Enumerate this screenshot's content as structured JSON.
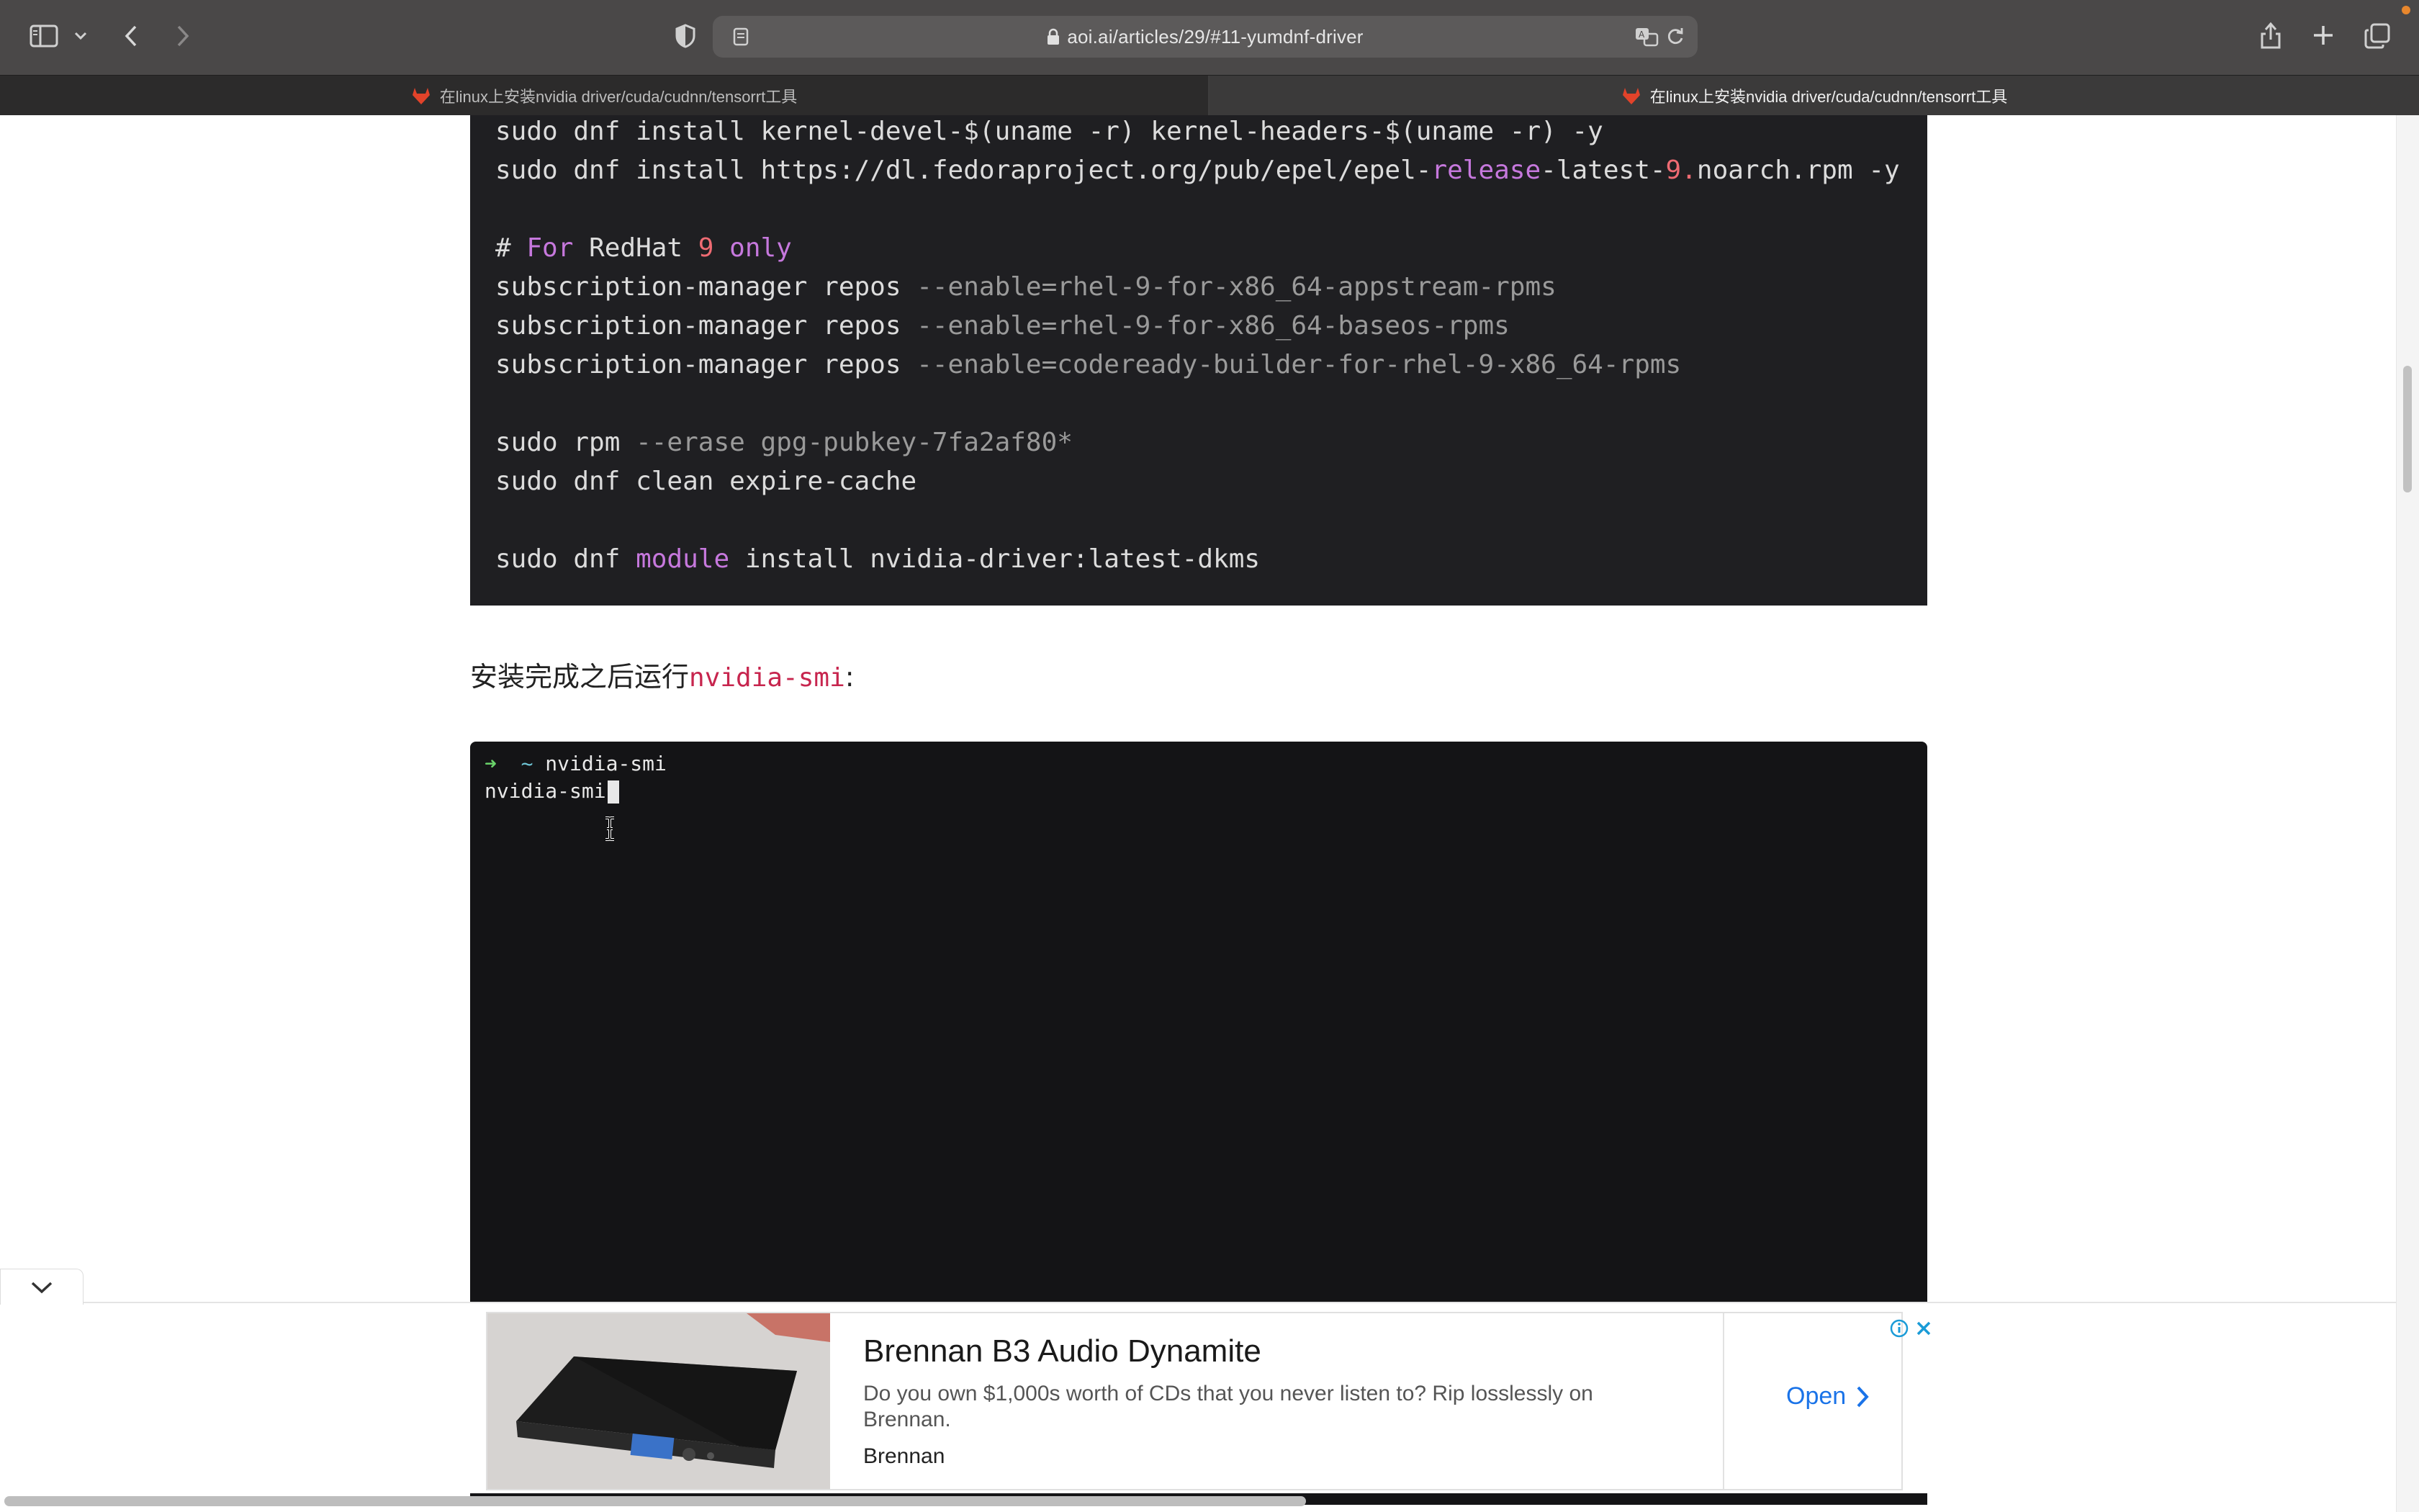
{
  "browser": {
    "url": "aoi.ai/articles/29/#11-yumdnf-driver",
    "tabs": [
      {
        "title": "在linux上安装nvidia driver/cuda/cudnn/tensorrt工具",
        "active": false
      },
      {
        "title": "在linux上安装nvidia driver/cuda/cudnn/tensorrt工具",
        "active": true
      }
    ],
    "icons": [
      "sidebar-icon",
      "chevron-down-icon",
      "back-icon",
      "forward-icon",
      "shield-icon",
      "reader-icon",
      "lock-icon",
      "translate-icon",
      "reload-icon",
      "share-icon",
      "new-tab-icon",
      "tab-overview-icon"
    ]
  },
  "code_block": {
    "lines": [
      {
        "parts": [
          {
            "t": "sudo dnf install kernel-devel-$(uname -r) kernel-headers-$(uname -r) -y",
            "c": ""
          }
        ]
      },
      {
        "parts": [
          {
            "t": "sudo dnf install https://dl.fedoraproject.org/pub/epel/epel-",
            "c": ""
          },
          {
            "t": "release",
            "c": "purple"
          },
          {
            "t": "-latest-",
            "c": ""
          },
          {
            "t": "9.",
            "c": "red"
          },
          {
            "t": "noarch.rpm -y",
            "c": ""
          }
        ]
      },
      {
        "parts": []
      },
      {
        "parts": [
          {
            "t": "# ",
            "c": ""
          },
          {
            "t": "For",
            "c": "purple"
          },
          {
            "t": " RedHat ",
            "c": ""
          },
          {
            "t": "9",
            "c": "red"
          },
          {
            "t": " ",
            "c": ""
          },
          {
            "t": "only",
            "c": "purple"
          }
        ]
      },
      {
        "parts": [
          {
            "t": "subscription-manager repos ",
            "c": ""
          },
          {
            "t": "--enable=rhel-9-for-x86_64-appstream-rpms",
            "c": "gray"
          }
        ]
      },
      {
        "parts": [
          {
            "t": "subscription-manager repos ",
            "c": ""
          },
          {
            "t": "--enable=rhel-9-for-x86_64-baseos-rpms",
            "c": "gray"
          }
        ]
      },
      {
        "parts": [
          {
            "t": "subscription-manager repos ",
            "c": ""
          },
          {
            "t": "--enable=codeready-builder-for-rhel-9-x86_64-rpms",
            "c": "gray"
          }
        ]
      },
      {
        "parts": []
      },
      {
        "parts": [
          {
            "t": "sudo rpm ",
            "c": ""
          },
          {
            "t": "--erase gpg-pubkey-7fa2af80*",
            "c": "gray"
          }
        ]
      },
      {
        "parts": [
          {
            "t": "sudo dnf clean expire-cache",
            "c": ""
          }
        ]
      },
      {
        "parts": []
      },
      {
        "parts": [
          {
            "t": "sudo dnf ",
            "c": ""
          },
          {
            "t": "module",
            "c": "purple"
          },
          {
            "t": " install nvidia-driver:latest-dkms",
            "c": ""
          }
        ]
      }
    ]
  },
  "paragraph": {
    "text": "安装完成之后运行",
    "inline_code": "nvidia-smi",
    "suffix": ":"
  },
  "terminal": {
    "prompt_arrow": "➜",
    "prompt_dir": "~",
    "command": "nvidia-smi",
    "echo_line": "nvidia-smi"
  },
  "ad": {
    "title": "Brennan B3 Audio Dynamite",
    "description": "Do you own $1,000s worth of CDs that you never listen to? Rip losslessly on Brennan.",
    "brand": "Brennan",
    "cta": "Open"
  },
  "colors": {
    "code_bg": "#1f1f22",
    "terminal_bg": "#141416",
    "inline_code": "#c7254e",
    "cta": "#1a73e8"
  }
}
